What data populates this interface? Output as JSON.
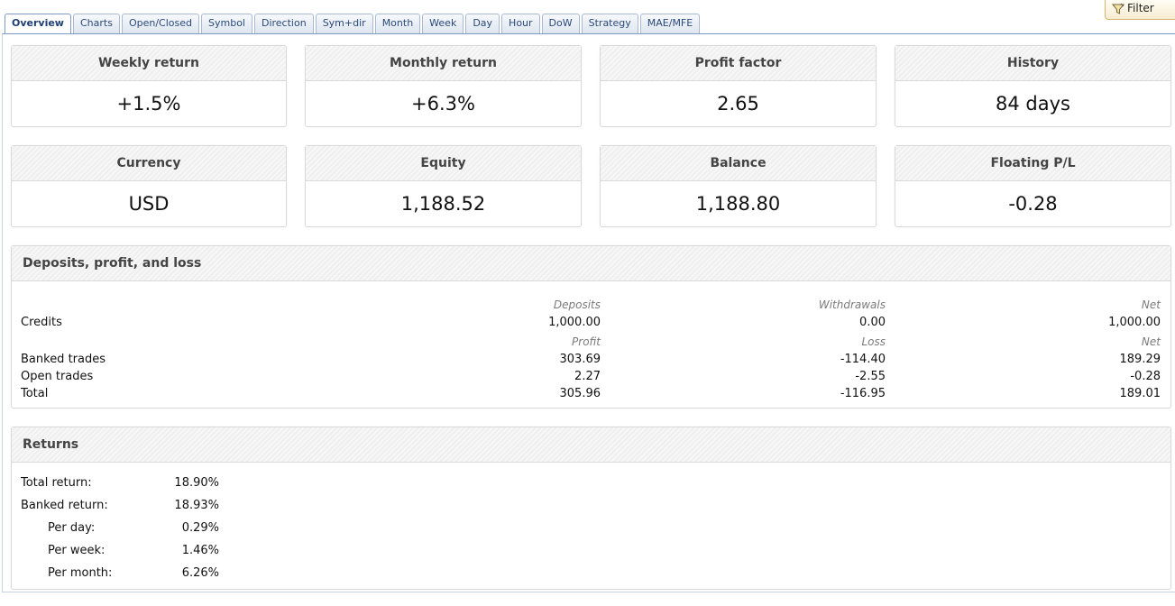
{
  "tabs": [
    "Overview",
    "Charts",
    "Open/Closed",
    "Symbol",
    "Direction",
    "Sym+dir",
    "Month",
    "Week",
    "Day",
    "Hour",
    "DoW",
    "Strategy",
    "MAE/MFE"
  ],
  "filter_label": "Filter",
  "stats": {
    "weekly_return": {
      "label": "Weekly return",
      "value": "+1.5%"
    },
    "monthly_return": {
      "label": "Monthly return",
      "value": "+6.3%"
    },
    "profit_factor": {
      "label": "Profit factor",
      "value": "2.65"
    },
    "history": {
      "label": "History",
      "value": "84 days"
    },
    "currency": {
      "label": "Currency",
      "value": "USD"
    },
    "equity": {
      "label": "Equity",
      "value": "1,188.52"
    },
    "balance": {
      "label": "Balance",
      "value": "1,188.80"
    },
    "floating_pl": {
      "label": "Floating P/L",
      "value": "-0.28"
    }
  },
  "colors": {
    "positive": "#1c8c1c",
    "negative": "#b41c1c",
    "tab_border": "#7f9bc4"
  },
  "deposits": {
    "title": "Deposits, profit, and loss",
    "credits_header": [
      "Deposits",
      "Withdrawals",
      "Net"
    ],
    "credits": {
      "label": "Credits",
      "values": [
        "1,000.00",
        "0.00",
        "1,000.00"
      ]
    },
    "trades_header": [
      "Profit",
      "Loss",
      "Net"
    ],
    "banked": {
      "label": "Banked trades",
      "values": [
        "303.69",
        "-114.40",
        "189.29"
      ]
    },
    "open": {
      "label": "Open trades",
      "values": [
        "2.27",
        "-2.55",
        "-0.28"
      ]
    },
    "total": {
      "label": "Total",
      "values": [
        "305.96",
        "-116.95",
        "189.01"
      ]
    }
  },
  "returns": {
    "title": "Returns",
    "rows": [
      {
        "label": "Total return:",
        "value": "18.90%"
      },
      {
        "label": "Banked return:",
        "value": "18.93%"
      },
      {
        "label": "Per day:",
        "value": "0.29%"
      },
      {
        "label": "Per week:",
        "value": "1.46%"
      },
      {
        "label": "Per month:",
        "value": "6.26%"
      }
    ]
  }
}
